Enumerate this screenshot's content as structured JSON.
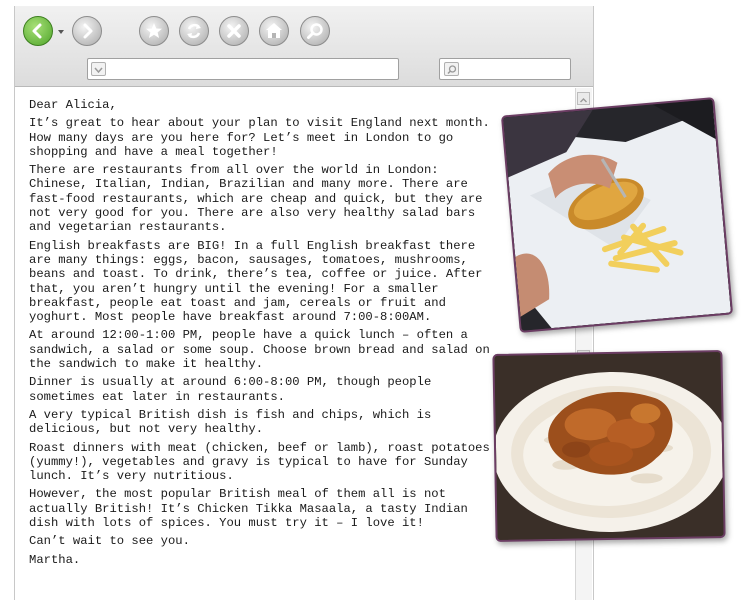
{
  "browser": {
    "address": {
      "value": "",
      "placeholder": ""
    },
    "search": {
      "value": "",
      "placeholder": ""
    },
    "icons": [
      "back-icon",
      "forward-icon",
      "star-icon",
      "refresh-icon",
      "stop-icon",
      "home-icon",
      "search-icon"
    ]
  },
  "letter": {
    "greeting": "Dear Alicia,",
    "paragraphs": [
      "It’s great to hear about your plan to visit England next month. How many days are you here for? Let’s meet in London to go shopping and have a meal together!",
      "There are restaurants from all over the world in London: Chinese, Italian, Indian, Brazilian and many more. There are fast-food restaurants, which are cheap and quick, but they are not very good for you. There are also very healthy salad bars and vegetarian restaurants.",
      "English breakfasts are BIG! In a full English breakfast there are many things: eggs, bacon, sausages, tomatoes, mushrooms, beans and toast. To drink, there’s tea, coffee or juice. After that, you aren’t hungry until the evening! For a smaller breakfast, people eat toast and jam, cereals or fruit and yoghurt. Most people have breakfast around 7:00-8:00AM.",
      "At around 12:00-1:00 PM, people have a quick lunch – often a sandwich, a salad or some soup. Choose brown bread and salad on the sandwich to make it healthy.",
      "Dinner is usually at around 6:00-8:00 PM, though people sometimes eat later in restaurants.",
      "A very typical British dish is fish and chips, which is delicious, but not very healthy.",
      "Roast dinners with meat (chicken, beef or lamb), roast potatoes (yummy!), vegetables and gravy is typical to have for Sunday lunch. It’s very nutritious.",
      "However, the most popular British meal of them all is not actually British! It’s Chicken Tikka Masaala, a tasty Indian dish with lots of spices. You must try it – I love it!",
      "Can’t wait to see you."
    ],
    "signature": "Martha."
  },
  "colors": {
    "back_button": "#4fa52a",
    "photo_border": "#6b3d63"
  }
}
